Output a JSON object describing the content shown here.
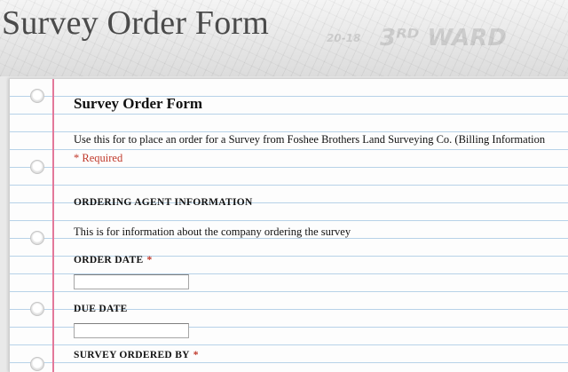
{
  "page": {
    "title": "Survey Order Form"
  },
  "header_watermark": {
    "text_1": "3ᴿᴰ WARD",
    "text_2": "20-18"
  },
  "form": {
    "title": "Survey Order Form",
    "description": "Use this for to place an order for a Survey from Foshee Brothers Land Surveying Co. (Billing Information",
    "required_note": "* Required",
    "section": {
      "header": "ORDERING AGENT INFORMATION",
      "description": "This is for information about the company ordering the survey"
    },
    "fields": [
      {
        "label": "ORDER DATE",
        "required_mark": "*",
        "value": ""
      },
      {
        "label": "DUE DATE",
        "value": ""
      },
      {
        "label": "SURVEY ORDERED BY",
        "required_mark": "*",
        "value": ""
      }
    ]
  },
  "colors": {
    "margin_line": "#e3789a",
    "rule_line": "#b7d2e8",
    "required": "#c0392b"
  }
}
